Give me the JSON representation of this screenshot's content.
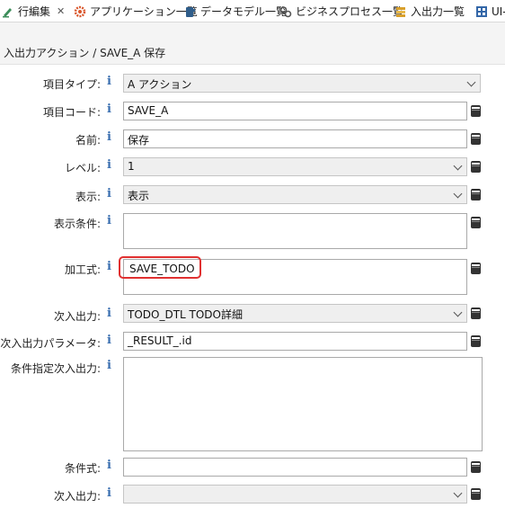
{
  "tabs": [
    {
      "label": "行編集",
      "icon": "row-edit-icon",
      "active": true
    },
    {
      "label": "アプリケーション一覧",
      "icon": "gear-icon"
    },
    {
      "label": "データモデル一覧",
      "icon": "database-icon"
    },
    {
      "label": "ビジネスプロセス一覧",
      "icon": "gears-icon"
    },
    {
      "label": "入出力一覧",
      "icon": "list-icon"
    },
    {
      "label": "UI-",
      "icon": "grid-icon"
    }
  ],
  "close_glyph": "✕",
  "breadcrumb": "入出力アクション / SAVE_A 保存",
  "info_glyph": "i",
  "form": {
    "item_type": {
      "label": "項目タイプ:",
      "value": "A アクション"
    },
    "item_code": {
      "label": "項目コード:",
      "value": "SAVE_A"
    },
    "name": {
      "label": "名前:",
      "value": "保存"
    },
    "level": {
      "label": "レベル:",
      "value": "1"
    },
    "display": {
      "label": "表示:",
      "value": "表示"
    },
    "display_condition": {
      "label": "表示条件:",
      "value": ""
    },
    "expression": {
      "label": "加工式:",
      "value": "SAVE_TODO"
    },
    "next_io": {
      "label": "次入出力:",
      "value": "TODO_DTL TODO詳細"
    },
    "next_io_param": {
      "label": "次入出力パラメータ:",
      "value": "_RESULT_.id"
    },
    "conditional_next_io": {
      "label": "条件指定次入出力:",
      "value": ""
    },
    "condition": {
      "label": "条件式:",
      "value": ""
    },
    "next_io_2": {
      "label": "次入出力:",
      "value": ""
    }
  },
  "colors": {
    "highlight": "#e03030",
    "info": "#3a6fb0"
  }
}
